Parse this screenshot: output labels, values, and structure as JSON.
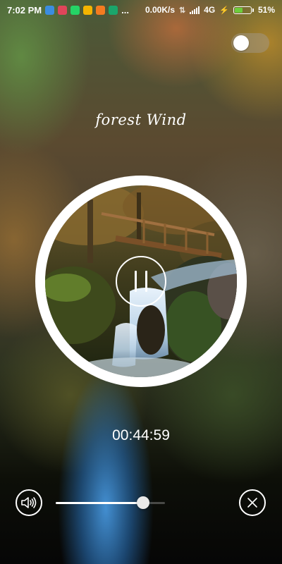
{
  "status_bar": {
    "time": "7:02 PM",
    "more": "...",
    "net_speed": "0.00K/s",
    "network_type": "4G",
    "battery_percent": "51%",
    "battery_level": 0.51,
    "notification_icons": [
      {
        "name": "notification-app-icon-1",
        "color": "#3b8de0"
      },
      {
        "name": "notification-app-icon-2",
        "color": "#e0455a"
      },
      {
        "name": "whatsapp-icon",
        "color": "#25d366"
      },
      {
        "name": "notification-app-icon-4",
        "color": "#f4b400"
      },
      {
        "name": "notification-app-icon-5",
        "color": "#f47b20"
      },
      {
        "name": "notification-app-icon-6",
        "color": "#1aa56b"
      }
    ]
  },
  "player": {
    "track_title": "forest Wind",
    "elapsed_time": "00:44:59",
    "is_playing": true,
    "volume_level": 0.8,
    "toggle_on": false
  },
  "icons": {
    "pause": "pause-icon",
    "volume": "volume-icon",
    "close": "close-icon"
  }
}
